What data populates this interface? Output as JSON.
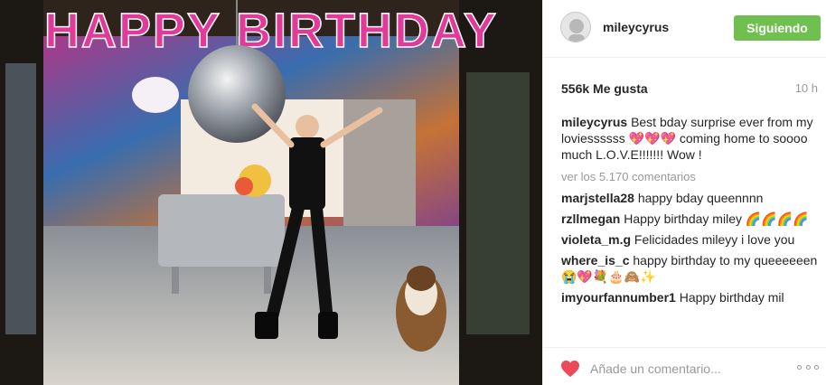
{
  "post": {
    "balloon_text": "HAPPY BIRTHDAY",
    "author": "mileycyrus",
    "follow_label": "Siguiendo",
    "likes": "556k Me gusta",
    "time": "10 h",
    "caption": {
      "user": "mileycyrus",
      "text": "Best bday surprise ever from my loviessssss 💖💖💖 coming home to soooo much L.O.V.E!!!!!!! Wow !"
    },
    "view_all_comments": "ver los 5.170 comentarios",
    "comments": [
      {
        "user": "marjstella28",
        "text": "happy bday queennnn"
      },
      {
        "user": "rzllmegan",
        "text": "Happy birthday miley 🌈🌈🌈🌈"
      },
      {
        "user": "violeta_m.g",
        "text": "Felicidades mileyy i love you"
      },
      {
        "user": "where_is_c",
        "text": "happy birthday to my queeeeeen😭💖💐🎂🙈✨"
      },
      {
        "user": "imyourfannumber1",
        "text": "Happy birthday mil"
      }
    ],
    "comment_placeholder": "Añade un comentario...",
    "colors": {
      "follow_button": "#70c050",
      "heart": "#ed4956",
      "muted_text": "#999999"
    },
    "icons": [
      "heart-icon",
      "more-options-icon",
      "avatar"
    ]
  }
}
